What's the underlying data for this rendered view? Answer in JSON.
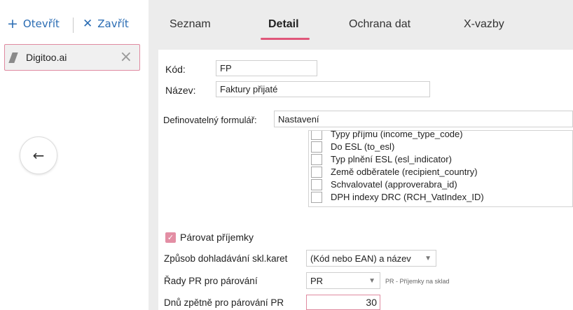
{
  "toolbar": {
    "open_label": "Otevřít",
    "close_label": "Zavřít",
    "open_icon": "plus-icon",
    "close_icon": "x-icon"
  },
  "open_document": {
    "label": "Digitoo.ai"
  },
  "tabs": [
    {
      "label": "Seznam",
      "active": false
    },
    {
      "label": "Detail",
      "active": true
    },
    {
      "label": "Ochrana dat",
      "active": false
    },
    {
      "label": "X-vazby",
      "active": false
    }
  ],
  "form": {
    "kod_label": "Kód:",
    "kod_value": "FP",
    "nazev_label": "Název:",
    "nazev_value": "Faktury přijaté",
    "definovatelny_label": "Definovatelný formulář:",
    "definovatelny_value": "Nastavení",
    "columns_list": [
      "Typy příjmu (income_type_code)",
      "Do ESL (to_esl)",
      "Typ plnění ESL (esl_indicator)",
      "Země odběratele (recipient_country)",
      "Schvalovatel (approverabra_id)",
      "DPH indexy DRC (RCH_VatIndex_ID)"
    ],
    "parovat_label": "Párovat příjemky",
    "parovat_checked": true,
    "zpusob_label": "Způsob dohladávání skl.karet",
    "zpusob_value": "(Kód nebo EAN) a název",
    "rady_label": "Řady PR pro párování",
    "rady_value": "PR",
    "rady_note": "PR - Příjemky na sklad",
    "dnu_label": "Dnů zpětně pro párování PR",
    "dnu_value": "30"
  },
  "colors": {
    "accent": "#e0577a",
    "link": "#2a6cb3",
    "panel_bg": "#ececec"
  }
}
